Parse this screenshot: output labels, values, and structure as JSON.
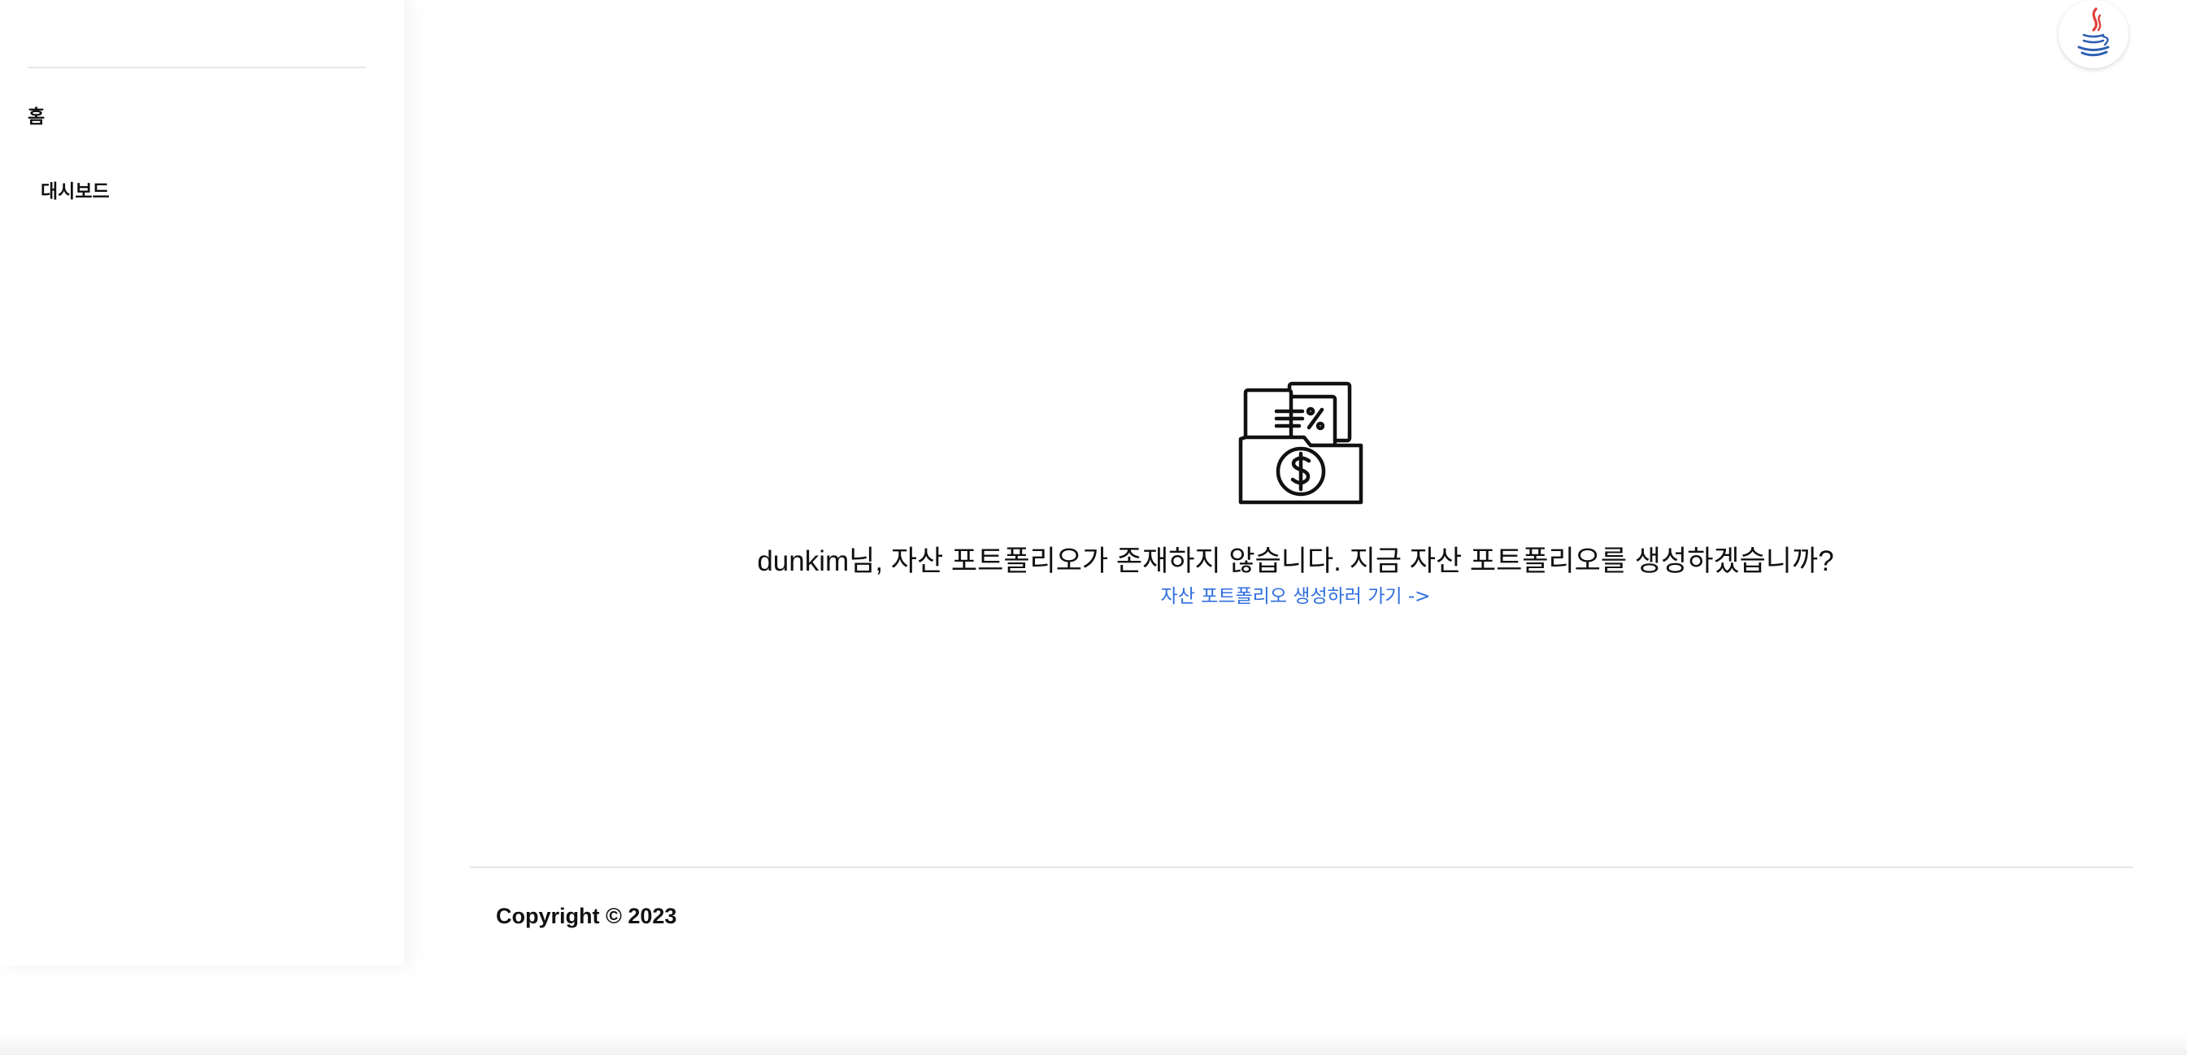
{
  "sidebar": {
    "heading": "홈",
    "items": [
      {
        "label": "대시보드",
        "icon": "dashboard"
      }
    ]
  },
  "header": {
    "avatar_icon": "java-coffee-cup-icon"
  },
  "main": {
    "illustration_icon": "folder-dollar-icon",
    "empty_title": "dunkim님, 자산 포트폴리오가 존재하지 않습니다. 지금 자산 포트폴리오를 생성하겠습니까?",
    "create_link": "자산 포트폴리오 생성하러 가기 ->"
  },
  "footer": {
    "copyright": "Copyright © 2023"
  },
  "colors": {
    "link": "#2f6fdf",
    "text": "#111111",
    "divider": "#e6e6e6",
    "background": "#ffffff"
  }
}
